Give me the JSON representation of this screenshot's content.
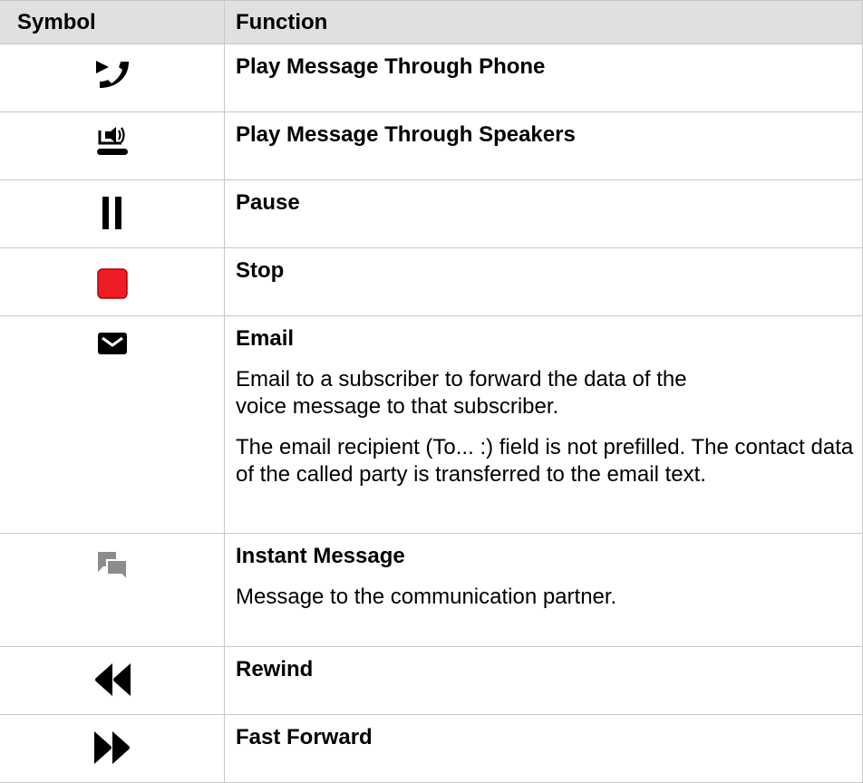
{
  "header": {
    "symbol_label": "Symbol",
    "function_label": "Function"
  },
  "rows": [
    {
      "icon": "play-through-phone-icon",
      "title": "Play Message Through Phone",
      "details": []
    },
    {
      "icon": "play-through-speakers-icon",
      "title": "Play Message Through Speakers",
      "details": []
    },
    {
      "icon": "pause-icon",
      "title": "Pause",
      "details": []
    },
    {
      "icon": "stop-icon",
      "title": "Stop",
      "details": []
    },
    {
      "icon": "email-icon",
      "title": "Email",
      "details": [
        "Email to a subscriber to forward the data of the voice message to that subscriber.",
        "The email recipient (To... :) field is not prefilled. The contact data of the called party is transferred to the email text."
      ]
    },
    {
      "icon": "instant-message-icon",
      "title": "Instant Message",
      "details": [
        "Message to the communication partner."
      ]
    },
    {
      "icon": "rewind-icon",
      "title": "Rewind",
      "details": []
    },
    {
      "icon": "fast-forward-icon",
      "title": "Fast Forward",
      "details": []
    }
  ],
  "colors": {
    "header_bg": "#e0e0e0",
    "border": "#c8c8c8",
    "stop_red": "#ee1c25",
    "im_gray": "#8c8c8c",
    "icon_black": "#000000"
  }
}
